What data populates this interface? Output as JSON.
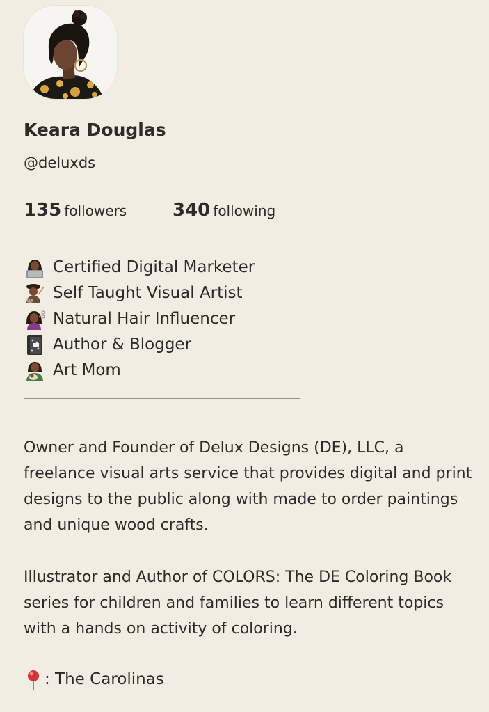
{
  "profile": {
    "name": "Keara Douglas",
    "handle": "@deluxds",
    "followers_count": "135",
    "followers_label": "followers",
    "following_count": "340",
    "following_label": "following"
  },
  "bio_lines": [
    {
      "icon": "woman-technologist-icon",
      "text": "Certified Digital Marketer"
    },
    {
      "icon": "woman-artist-icon",
      "text": "Self Taught Visual Artist"
    },
    {
      "icon": "woman-haircut-icon",
      "text": "Natural Hair Influencer"
    },
    {
      "icon": "notebook-icon",
      "text": "Author & Blogger"
    },
    {
      "icon": "woman-feeding-baby-icon",
      "text": "Art Mom"
    }
  ],
  "divider": "____________________________________________",
  "paragraphs": [
    "Owner and Founder of Delux Designs (DE), LLC, a freelance visual arts service that provides digital and print designs to the public along with made to order paintings and unique wood crafts.",
    "Illustrator and Author of COLORS: The DE Coloring Book series for children and families to learn different topics with a hands on activity of coloring."
  ],
  "location": {
    "icon": "round-pushpin-icon",
    "text": ": The Carolinas"
  },
  "colors": {
    "background": "#f2ede3",
    "text": "#2b2b2b"
  }
}
